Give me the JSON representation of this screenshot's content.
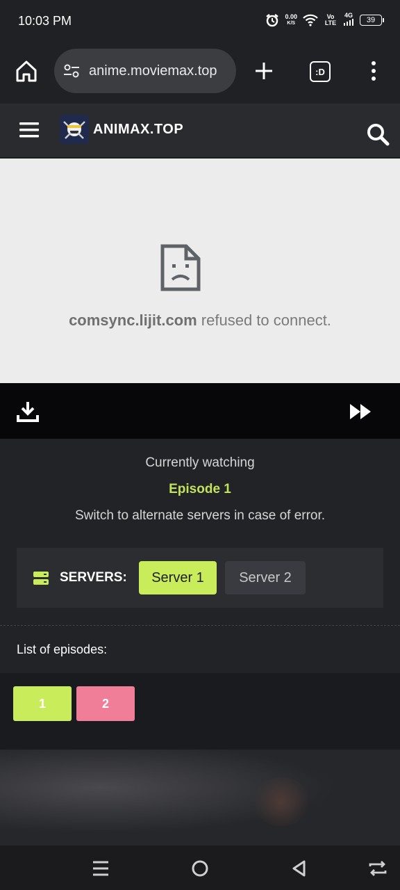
{
  "status_bar": {
    "time": "10:03 PM",
    "net_speed": "0.00",
    "net_unit": "K/S",
    "volte": "Vo LTE",
    "network": "4G",
    "battery": "39"
  },
  "browser": {
    "url": "anime.moviemax.top",
    "tab_switcher_label": ":D"
  },
  "site": {
    "brand": "ANIMAX.TOP"
  },
  "error": {
    "host": "comsync.lijit.com",
    "message": " refused to connect."
  },
  "info": {
    "currently_watching": "Currently watching",
    "episode": "Episode 1",
    "switch_note": "Switch to alternate servers in case of error.",
    "servers_label": "SERVERS:",
    "servers": [
      "Server 1",
      "Server 2"
    ],
    "active_server": "Server 1"
  },
  "episodes": {
    "title": "List of episodes:",
    "items": [
      "1",
      "2"
    ]
  },
  "colors": {
    "accent_green": "#c9ec5a",
    "accent_pink": "#f07e98"
  }
}
